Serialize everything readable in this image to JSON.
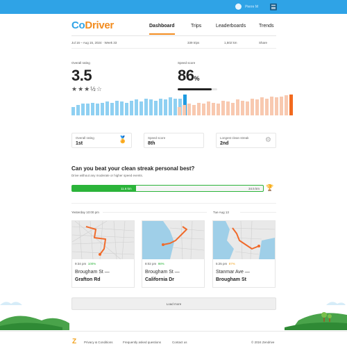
{
  "topbar": {
    "user_name": "Pierre M",
    "colors": {
      "bar": "#2fa3e6"
    }
  },
  "header": {
    "logo_co": "Co",
    "logo_driver": "Driver",
    "nav": [
      "Dashboard",
      "Trips",
      "Leaderboards",
      "Trends"
    ]
  },
  "subbar": {
    "date": "Jul 16 – Aug 15, 2024 · Week 33",
    "trips": "339 trips",
    "distance": "1,502 km",
    "share": "Share"
  },
  "rating": {
    "label": "Overall rating",
    "value": "3.5",
    "stars": "★★★½☆",
    "stars_value": 3.5,
    "bars": [
      0.4,
      0.5,
      0.55,
      0.55,
      0.6,
      0.55,
      0.6,
      0.65,
      0.6,
      0.7,
      0.65,
      0.6,
      0.7,
      0.75,
      0.65,
      0.8,
      0.75,
      0.7,
      0.8,
      0.75,
      0.85,
      0.8,
      0.8,
      1.0
    ],
    "color": "#8fd0f2",
    "accent": "#1f9be0"
  },
  "speed": {
    "label": "Speed score",
    "value": "86",
    "unit": "%",
    "level": 0.86,
    "bars": [
      0.4,
      0.5,
      0.55,
      0.5,
      0.6,
      0.55,
      0.65,
      0.6,
      0.55,
      0.7,
      0.65,
      0.6,
      0.75,
      0.7,
      0.65,
      0.8,
      0.75,
      0.85,
      0.8,
      0.9,
      0.85,
      0.9,
      0.95,
      1.0
    ],
    "color": "#f8c9b0",
    "accent": "#f26a1f"
  },
  "cards": [
    {
      "label": "Overall rating",
      "value": "1st",
      "icon": "gold-medal-icon",
      "glyph": "🏅"
    },
    {
      "label": "Speed score",
      "value": "8th",
      "icon": "",
      "glyph": ""
    },
    {
      "label": "Longest clean streak",
      "value": "2nd",
      "icon": "silver-medal-icon",
      "glyph": "⚙"
    }
  ],
  "challenge": {
    "question": "Can you beat your clean streak personal best?",
    "subtitle": "Drive without any moderate or higher speed events.",
    "current": "11.6 km",
    "best": "34.5 km",
    "progress": 0.336,
    "trophy": "trophy-icon"
  },
  "days": [
    {
      "label": "Yesterday 10:00 pm"
    },
    {
      "label": "Tue Aug 13"
    }
  ],
  "trips": [
    {
      "time": "9:34 pm",
      "score": "100%",
      "from": "Brougham St —",
      "to": "Grafton Rd"
    },
    {
      "time": "8:02 pm",
      "score": "98%",
      "from": "Brougham St —",
      "to": "California Dr"
    },
    {
      "time": "5:25 pm",
      "score": "87%",
      "from": "Stanmar Ave —",
      "to": "Brougham St"
    }
  ],
  "load_more": "Load more",
  "footer": {
    "links": [
      "Privacy & Conditions",
      "Frequently asked questions",
      "Contact us"
    ],
    "copyright": "© 2024 Zendrive"
  }
}
